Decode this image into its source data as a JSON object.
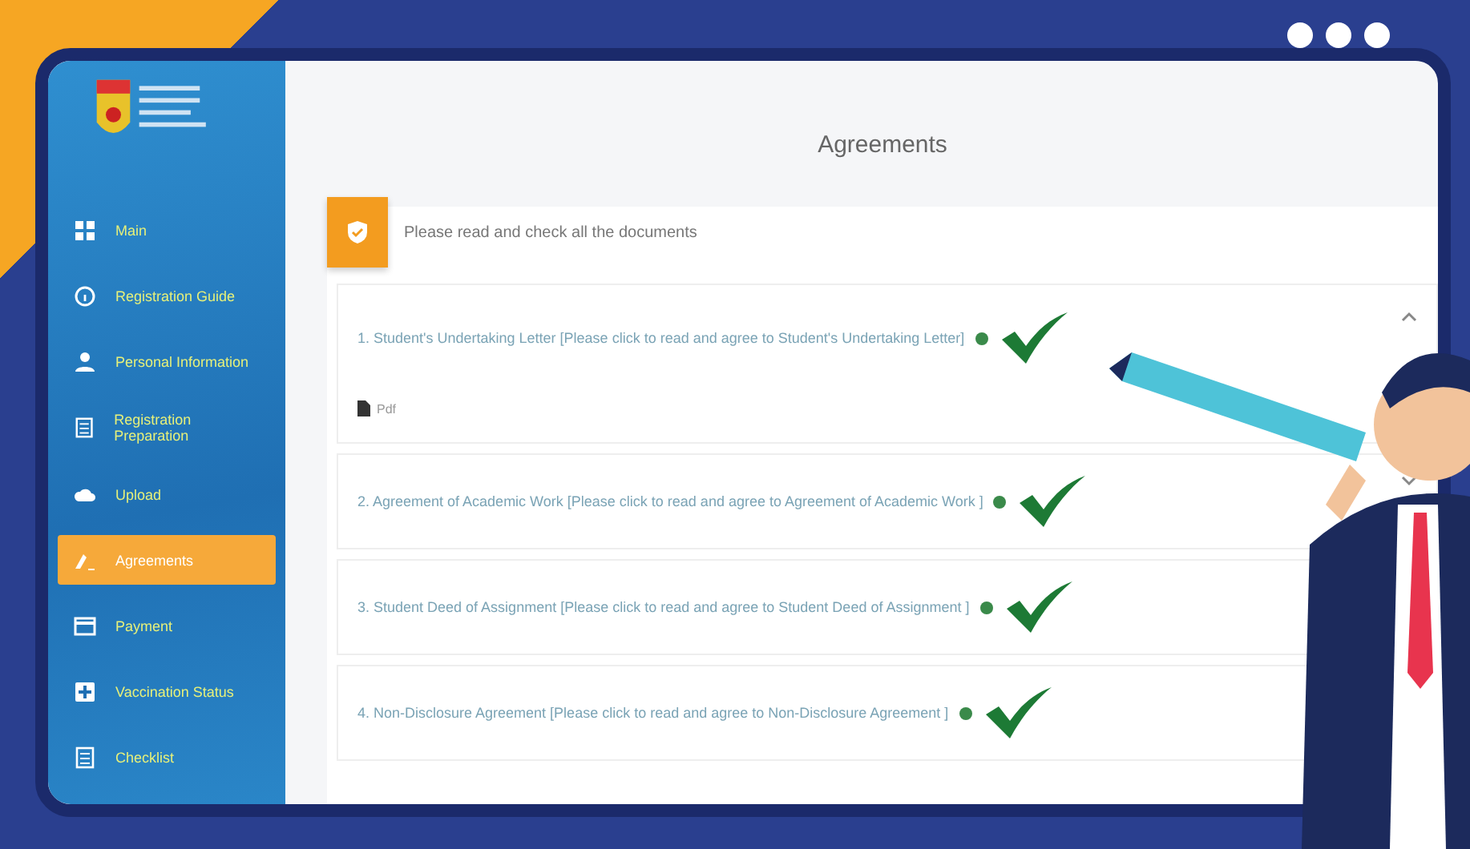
{
  "sidebar": {
    "items": [
      {
        "label": "Main",
        "selected": false
      },
      {
        "label": "Registration Guide",
        "selected": false
      },
      {
        "label": "Personal Information",
        "selected": false
      },
      {
        "label": "Registration Preparation",
        "selected": false
      },
      {
        "label": "Upload",
        "selected": false
      },
      {
        "label": "Agreements",
        "selected": true
      },
      {
        "label": "Payment",
        "selected": false
      },
      {
        "label": "Vaccination Status",
        "selected": false
      },
      {
        "label": "Checklist",
        "selected": false
      }
    ]
  },
  "page": {
    "title": "Agreements"
  },
  "card": {
    "header": "Please read and check all the documents",
    "documents": [
      {
        "label": "1. Student's Undertaking Letter [Please click to read and agree to Student's Undertaking Letter]",
        "expanded": true,
        "checked": true,
        "attachment": "Pdf"
      },
      {
        "label": "2. Agreement of Academic Work [Please click to read and agree to Agreement of Academic Work ]",
        "expanded": false,
        "checked": true
      },
      {
        "label": "3. Student Deed of Assignment [Please click to read and agree to Student Deed of Assignment ]",
        "expanded": false,
        "checked": true
      },
      {
        "label": "4. Non-Disclosure Agreement [Please click to read and agree to Non-Disclosure Agreement ]",
        "expanded": false,
        "checked": true
      }
    ]
  }
}
